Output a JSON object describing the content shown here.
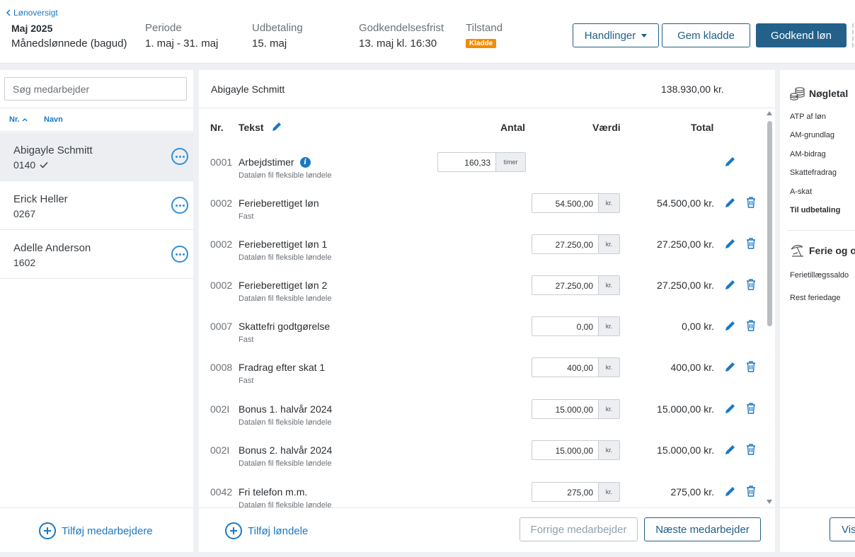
{
  "header": {
    "back_label": "Lønoversigt",
    "period_title": "Maj 2025",
    "period_subtitle": "Månedslønnede (bagud)",
    "periode_label": "Periode",
    "periode_value": "1. maj - 31. maj",
    "udbetaling_label": "Udbetaling",
    "udbetaling_value": "15. maj",
    "frist_label": "Godkendelsesfrist",
    "frist_value": "13. maj kl. 16:30",
    "tilstand_label": "Tilstand",
    "tilstand_badge": "Kladde",
    "actions_label": "Handlinger",
    "save_label": "Gem kladde",
    "approve_label": "Godkend løn"
  },
  "colors": {
    "primary": "#23618a",
    "link": "#1b78c2",
    "badge": "#f08c00",
    "icon": "#2f8fd8"
  },
  "sidebar": {
    "search_placeholder": "Søg medarbejder",
    "sort_nr": "Nr.",
    "sort_navn": "Navn",
    "employees": [
      {
        "name": "Abigayle Schmitt",
        "number": "0140",
        "selected": true,
        "approved": true
      },
      {
        "name": "Erick Heller",
        "number": "0267",
        "selected": false,
        "approved": false
      },
      {
        "name": "Adelle Anderson",
        "number": "1602",
        "selected": false,
        "approved": false
      }
    ],
    "add_label": "Tilføj medarbejdere"
  },
  "main": {
    "employee_name": "Abigayle Schmitt",
    "employee_total": "138.930,00 kr.",
    "columns": {
      "nr": "Nr.",
      "tekst": "Tekst",
      "antal": "Antal",
      "vaerdi": "Værdi",
      "total": "Total"
    },
    "rows": [
      {
        "nr": "0001",
        "text": "Arbejdstimer",
        "sub": "Dataløn fil fleksible løndele",
        "antal": "160,33",
        "antal_unit": "timer",
        "info": true
      },
      {
        "nr": "0002",
        "text": "Ferieberettiget løn",
        "sub": "Fast",
        "value": "54.500,00",
        "unit": "kr.",
        "total": "54.500,00 kr."
      },
      {
        "nr": "0002",
        "text": "Ferieberettiget løn 1",
        "sub": "Dataløn fil fleksible løndele",
        "value": "27.250,00",
        "unit": "kr.",
        "total": "27.250,00 kr."
      },
      {
        "nr": "0002",
        "text": "Ferieberettiget løn 2",
        "sub": "Dataløn fil fleksible løndele",
        "value": "27.250,00",
        "unit": "kr.",
        "total": "27.250,00 kr."
      },
      {
        "nr": "0007",
        "text": "Skattefri godtgørelse",
        "sub": "Fast",
        "value": "0,00",
        "unit": "kr.",
        "total": "0,00 kr."
      },
      {
        "nr": "0008",
        "text": "Fradrag efter skat 1",
        "sub": "Fast",
        "value": "400,00",
        "unit": "kr.",
        "total": "400,00 kr."
      },
      {
        "nr": "002I",
        "text": "Bonus 1. halvår 2024",
        "sub": "Dataløn fil fleksible løndele",
        "value": "15.000,00",
        "unit": "kr.",
        "total": "15.000,00 kr."
      },
      {
        "nr": "002I",
        "text": "Bonus 2. halvår 2024",
        "sub": "Dataløn fil fleksible løndele",
        "value": "15.000,00",
        "unit": "kr.",
        "total": "15.000,00 kr."
      },
      {
        "nr": "0042",
        "text": "Fri telefon m.m.",
        "sub": "Dataløn fil fleksible løndele",
        "value": "275,00",
        "unit": "kr.",
        "total": "275,00 kr."
      }
    ],
    "add_label": "Tilføj løndele",
    "prev_label": "Forrige medarbejder",
    "next_label": "Næste medarbejder"
  },
  "right": {
    "key_title": "Nøgletal",
    "key_items": [
      "ATP af løn",
      "AM-grundlag",
      "AM-bidrag",
      "Skattefradrag",
      "A-skat",
      "Til udbetaling"
    ],
    "ferie_title": "Ferie og o",
    "ferie_items": [
      "Ferietillægssaldo",
      "Rest feriedage"
    ],
    "show_label": "Vis"
  }
}
